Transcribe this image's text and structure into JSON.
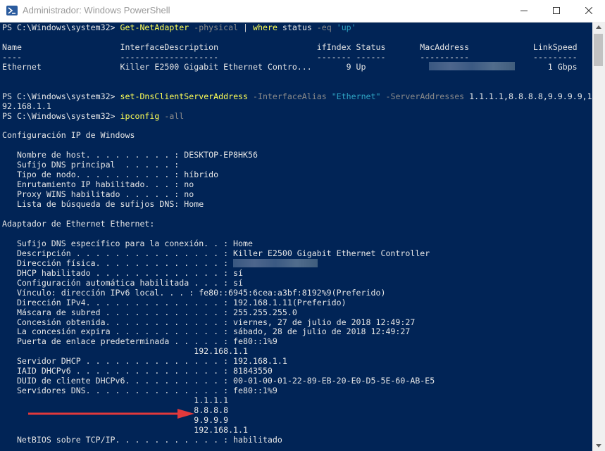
{
  "window": {
    "title": "Administrador: Windows PowerShell",
    "colors": {
      "background": "#012456",
      "text": "#e6e6e6",
      "command": "#ffff55",
      "parameter": "#8a8a8a",
      "string": "#2fa4c4",
      "arrow": "#e2393b"
    }
  },
  "console": {
    "lines": [
      [
        {
          "t": "PS C:\\Windows\\system32> ",
          "c": "n"
        },
        {
          "t": "Get-NetAdapter",
          "c": "cmd"
        },
        {
          "t": " -physical",
          "c": "param"
        },
        {
          "t": " | ",
          "c": "op"
        },
        {
          "t": "where",
          "c": "cmd"
        },
        {
          "t": " status ",
          "c": "n"
        },
        {
          "t": "-eq",
          "c": "param"
        },
        {
          "t": " 'up'",
          "c": "str"
        }
      ],
      [],
      [
        {
          "t": "Name                    InterfaceDescription                    ifIndex Status       MacAddress             LinkSpeed",
          "c": "n"
        }
      ],
      [
        {
          "t": "----                    --------------------                    ------- ------       ----------             ---------",
          "c": "n"
        }
      ],
      [
        {
          "t": "Ethernet                Killer E2500 Gigabit Ethernet Contro...       9 Up                                     1 Gbps",
          "c": "n"
        }
      ],
      [],
      [],
      [
        {
          "t": "PS C:\\Windows\\system32> ",
          "c": "n"
        },
        {
          "t": "set-DnsClientServerAddress",
          "c": "cmd"
        },
        {
          "t": " -InterfaceAlias ",
          "c": "param"
        },
        {
          "t": "\"Ethernet\"",
          "c": "str"
        },
        {
          "t": " -ServerAddresses ",
          "c": "param"
        },
        {
          "t": "1.1.1.1,8.8.8.8,9.9.9.9,1",
          "c": "n"
        }
      ],
      [
        {
          "t": "92.168.1.1",
          "c": "n"
        }
      ],
      [
        {
          "t": "PS C:\\Windows\\system32> ",
          "c": "n"
        },
        {
          "t": "ipconfig",
          "c": "cmd"
        },
        {
          "t": " -all",
          "c": "param"
        }
      ],
      [],
      [
        {
          "t": "Configuración IP de Windows",
          "c": "n"
        }
      ],
      [],
      [
        {
          "t": "   Nombre de host. . . . . . . . . : DESKTOP-EP8HK56",
          "c": "n"
        }
      ],
      [
        {
          "t": "   Sufijo DNS principal  . . . . . :",
          "c": "n"
        }
      ],
      [
        {
          "t": "   Tipo de nodo. . . . . . . . . . : híbrido",
          "c": "n"
        }
      ],
      [
        {
          "t": "   Enrutamiento IP habilitado. . . : no",
          "c": "n"
        }
      ],
      [
        {
          "t": "   Proxy WINS habilitado . . . . . : no",
          "c": "n"
        }
      ],
      [
        {
          "t": "   Lista de búsqueda de sufijos DNS: Home",
          "c": "n"
        }
      ],
      [],
      [
        {
          "t": "Adaptador de Ethernet Ethernet:",
          "c": "n"
        }
      ],
      [],
      [
        {
          "t": "   Sufijo DNS específico para la conexión. . : Home",
          "c": "n"
        }
      ],
      [
        {
          "t": "   Descripción . . . . . . . . . . . . . . . : Killer E2500 Gigabit Ethernet Controller",
          "c": "n"
        }
      ],
      [
        {
          "t": "   Dirección física. . . . . . . . . . . . . :",
          "c": "n"
        }
      ],
      [
        {
          "t": "   DHCP habilitado . . . . . . . . . . . . . : sí",
          "c": "n"
        }
      ],
      [
        {
          "t": "   Configuración automática habilitada . . . : sí",
          "c": "n"
        }
      ],
      [
        {
          "t": "   Vínculo: dirección IPv6 local. . . : fe80::6945:6cea:a3bf:8192%9(Preferido)",
          "c": "n"
        }
      ],
      [
        {
          "t": "   Dirección IPv4. . . . . . . . . . . . . . : 192.168.1.11(Preferido)",
          "c": "n"
        }
      ],
      [
        {
          "t": "   Máscara de subred . . . . . . . . . . . . : 255.255.255.0",
          "c": "n"
        }
      ],
      [
        {
          "t": "   Concesión obtenida. . . . . . . . . . . . : viernes, 27 de julio de 2018 12:49:27",
          "c": "n"
        }
      ],
      [
        {
          "t": "   La concesión expira . . . . . . . . . . . : sábado, 28 de julio de 2018 12:49:27",
          "c": "n"
        }
      ],
      [
        {
          "t": "   Puerta de enlace predeterminada . . . . . : fe80::1%9",
          "c": "n"
        }
      ],
      [
        {
          "t": "                                       192.168.1.1",
          "c": "n"
        }
      ],
      [
        {
          "t": "   Servidor DHCP . . . . . . . . . . . . . . : 192.168.1.1",
          "c": "n"
        }
      ],
      [
        {
          "t": "   IAID DHCPv6 . . . . . . . . . . . . . . . : 81843550",
          "c": "n"
        }
      ],
      [
        {
          "t": "   DUID de cliente DHCPv6. . . . . . . . . . : 00-01-00-01-22-89-EB-20-E0-D5-5E-60-AB-E5",
          "c": "n"
        }
      ],
      [
        {
          "t": "   Servidores DNS. . . . . . . . . . . . . . : fe80::1%9",
          "c": "n"
        }
      ],
      [
        {
          "t": "                                       1.1.1.1",
          "c": "n"
        }
      ],
      [
        {
          "t": "                                       8.8.8.8",
          "c": "n"
        }
      ],
      [
        {
          "t": "                                       9.9.9.9",
          "c": "n"
        }
      ],
      [
        {
          "t": "                                       192.168.1.1",
          "c": "n"
        }
      ],
      [
        {
          "t": "   NetBIOS sobre TCP/IP. . . . . . . . . . . : habilitado",
          "c": "n"
        }
      ]
    ]
  }
}
